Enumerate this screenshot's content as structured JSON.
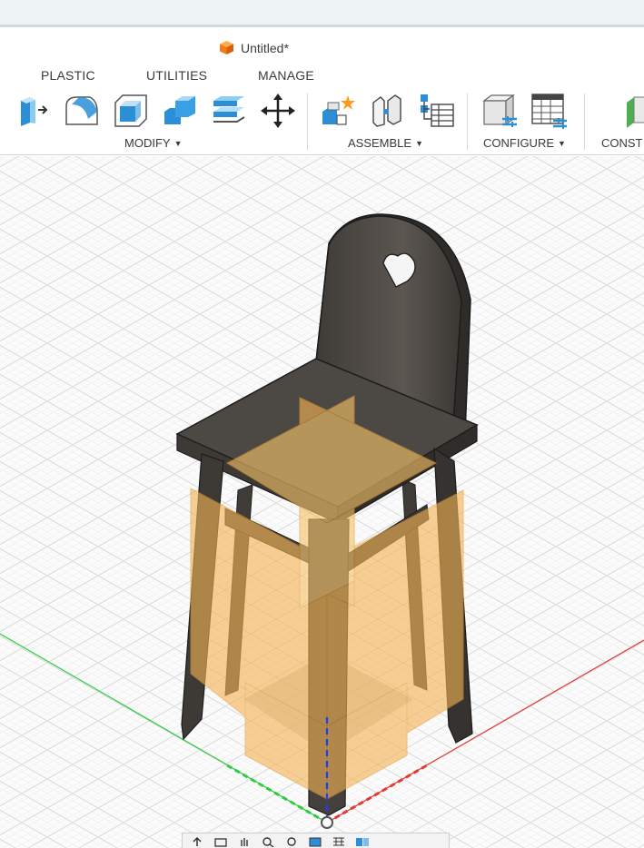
{
  "app": {
    "document_title": "Untitled*",
    "document_icon": "orange-cube-icon"
  },
  "tabs": [
    {
      "label": "PLASTIC"
    },
    {
      "label": "UTILITIES"
    },
    {
      "label": "MANAGE"
    }
  ],
  "toolbar": {
    "groups": [
      {
        "label": "MODIFY",
        "has_dropdown": true
      },
      {
        "label": "ASSEMBLE",
        "has_dropdown": true
      },
      {
        "label": "CONFIGURE",
        "has_dropdown": true
      },
      {
        "label": "CONST"
      }
    ],
    "modify_tools": [
      "press-pull-icon",
      "fillet-icon",
      "shell-icon",
      "combine-icon",
      "offset-face-icon",
      "move-icon"
    ],
    "assemble_tools": [
      "new-component-icon",
      "joint-icon",
      "component-tree-icon"
    ],
    "configure_tools": [
      "configure-model-icon",
      "configuration-table-icon"
    ],
    "construct_tools": [
      "construct-plane-icon"
    ]
  },
  "colors": {
    "accent_blue": "#2a8fd6",
    "chair_dark": "#4c4843",
    "plane_orange": "#f4b454",
    "axis_red": "#e53935",
    "axis_green": "#2ecc40",
    "axis_blue": "#1e3cff"
  },
  "navigation_bar": {
    "icons": [
      "orbit-icon",
      "look-at-icon",
      "pan-icon",
      "zoom-icon",
      "fit-icon",
      "display-settings-icon",
      "grid-settings-icon",
      "viewports-icon"
    ]
  }
}
